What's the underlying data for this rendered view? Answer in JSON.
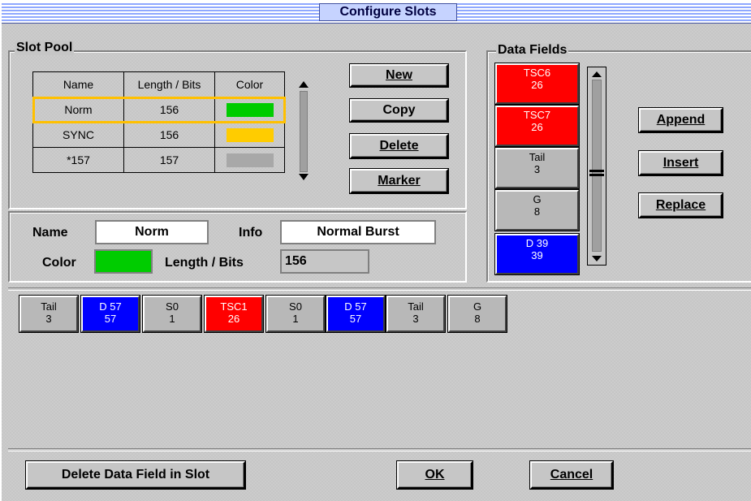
{
  "window": {
    "title": "Configure Slots"
  },
  "slot_pool": {
    "label": "Slot Pool",
    "columns": [
      "Name",
      "Length / Bits",
      "Color"
    ],
    "rows": [
      {
        "name": "Norm",
        "length": "156",
        "color": "#00cc00"
      },
      {
        "name": "SYNC",
        "length": "156",
        "color": "#ffcc00"
      },
      {
        "name": "*157",
        "length": "157",
        "color": "#a8a8a8"
      }
    ],
    "buttons": {
      "new": "New",
      "copy": "Copy",
      "delete": "Delete",
      "marker": "Marker"
    }
  },
  "details": {
    "name_label": "Name",
    "name_value": "Norm",
    "info_label": "Info",
    "info_value": "Normal Burst",
    "color_label": "Color",
    "color_value": "#00cc00",
    "length_label": "Length / Bits",
    "length_value": "156"
  },
  "data_fields": {
    "label": "Data Fields",
    "items": [
      {
        "name": "TSC6",
        "bits": "26",
        "color": "red"
      },
      {
        "name": "TSC7",
        "bits": "26",
        "color": "red"
      },
      {
        "name": "Tail",
        "bits": "3",
        "color": "gray"
      },
      {
        "name": "G",
        "bits": "8",
        "color": "gray"
      },
      {
        "name": "D 39",
        "bits": "39",
        "color": "blue"
      }
    ],
    "buttons": {
      "append": "Append",
      "insert": "Insert",
      "replace": "Replace"
    }
  },
  "slot_fields": [
    {
      "name": "Tail",
      "bits": "3",
      "color": "gray"
    },
    {
      "name": "D 57",
      "bits": "57",
      "color": "blue"
    },
    {
      "name": "S0",
      "bits": "1",
      "color": "gray"
    },
    {
      "name": "TSC1",
      "bits": "26",
      "color": "red"
    },
    {
      "name": "S0",
      "bits": "1",
      "color": "gray"
    },
    {
      "name": "D 57",
      "bits": "57",
      "color": "blue"
    },
    {
      "name": "Tail",
      "bits": "3",
      "color": "gray"
    },
    {
      "name": "G",
      "bits": "8",
      "color": "gray"
    }
  ],
  "footer": {
    "delete_field": "Delete Data Field in Slot",
    "ok": "OK",
    "cancel": "Cancel"
  }
}
